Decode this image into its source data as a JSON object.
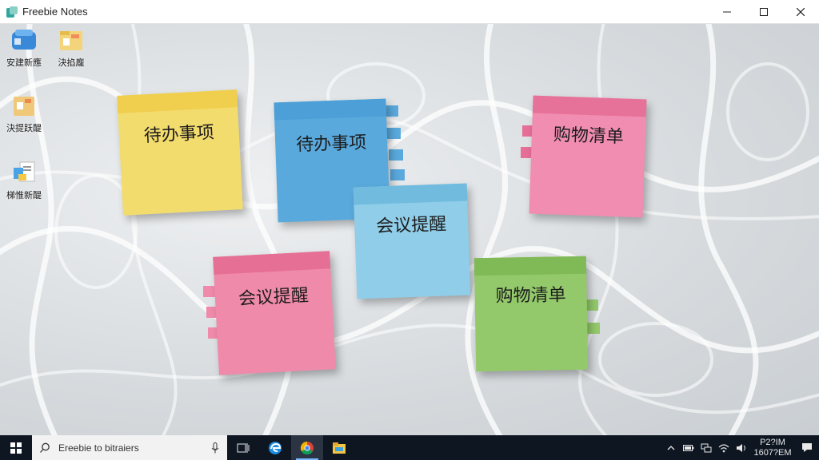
{
  "window": {
    "title": "Freebie Notes",
    "controls": [
      "minimize",
      "maximize",
      "close"
    ]
  },
  "desktop_icons": [
    {
      "label": "安建新應",
      "icon": "blue-folder-icon"
    },
    {
      "label": "決掐龐",
      "icon": "yellow-folder-icon"
    },
    {
      "label": "決提跃醍",
      "icon": "note-folder-icon"
    },
    {
      "label": "梯惟新醍",
      "icon": "document-icon"
    }
  ],
  "notes": [
    {
      "text": "待办事项",
      "color": "#f3dc6e",
      "band": "#f0cc4a"
    },
    {
      "text": "待办事项",
      "color": "#5aa9dd",
      "band": "#4a9ed6"
    },
    {
      "text": "购物清单",
      "color": "#f08db0",
      "band": "#e66f97"
    },
    {
      "text": "会议提醒",
      "color": "#8fcde8",
      "band": "#6db9dd"
    },
    {
      "text": "会议提醒",
      "color": "#f08aab",
      "band": "#e46c92"
    },
    {
      "text": "购物清单",
      "color": "#93c96b",
      "band": "#7eb855"
    }
  ],
  "taskbar": {
    "search_placeholder": "Ereebie to bitraiers",
    "apps": [
      "task-view-icon",
      "edge-icon",
      "chrome-icon",
      "file-explorer-icon"
    ],
    "tray": {
      "time": "P2?IM",
      "date": "1607?EM"
    }
  }
}
